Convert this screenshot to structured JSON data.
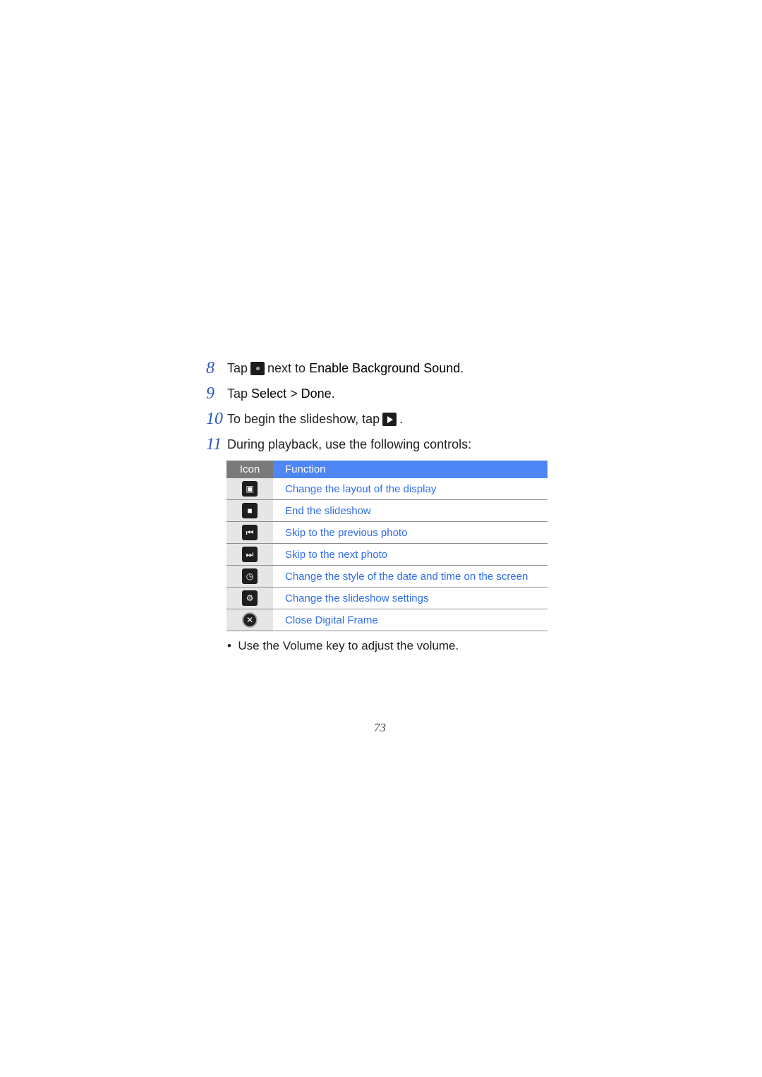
{
  "steps": [
    {
      "num": "8",
      "pre": "Tap",
      "icon": "sound-toggle-icon",
      "mid": "next to",
      "bold": "Enable Background Sound",
      "post": "."
    },
    {
      "num": "9",
      "pre": "Tap",
      "bold1": "Select",
      "sep": ">",
      "bold2": "Done",
      "post": "."
    },
    {
      "num": "10",
      "pre": "To begin the slideshow, tap",
      "icon": "play-icon",
      "post": "."
    },
    {
      "num": "11",
      "text": "During playback, use the following controls:"
    }
  ],
  "table": {
    "headers": {
      "icon": "Icon",
      "function": "Function"
    },
    "rows": [
      {
        "icon": "layout-icon",
        "glyph": "▣",
        "function": "Change the layout of the display"
      },
      {
        "icon": "stop-icon",
        "glyph": "■",
        "function": "End the slideshow"
      },
      {
        "icon": "previous-icon",
        "glyph": "⏮",
        "function": "Skip to the previous photo"
      },
      {
        "icon": "next-icon",
        "glyph": "⏭",
        "function": "Skip to the next photo"
      },
      {
        "icon": "clock-calendar-icon",
        "glyph": "◷",
        "function": "Change the style of the date and time on the screen"
      },
      {
        "icon": "gear-icon",
        "glyph": "⚙",
        "function": "Change the slideshow settings"
      },
      {
        "icon": "close-icon",
        "glyph": "✕",
        "function": "Close Digital Frame"
      }
    ]
  },
  "bullet": "Use the Volume key to adjust the volume.",
  "page_number": "73",
  "colors": {
    "header_blue": "#4e86f5",
    "header_gray": "#7a7a7a",
    "link_blue": "#2f6de8",
    "step_num": "#2b55c6"
  }
}
